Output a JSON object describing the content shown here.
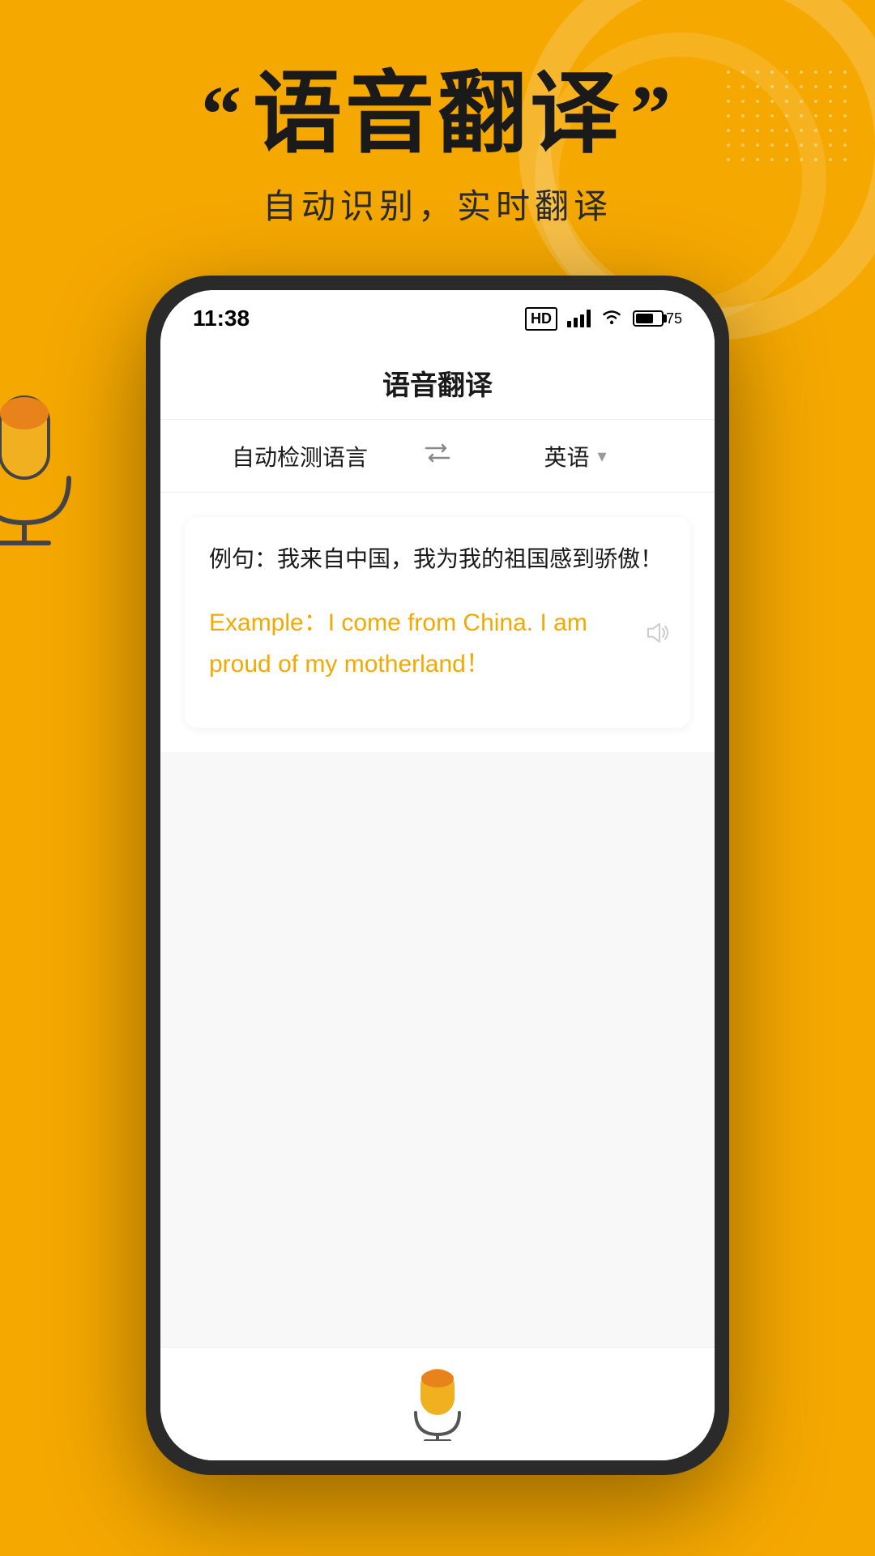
{
  "background": {
    "color": "#F5A800"
  },
  "header": {
    "quote_open": "“",
    "quote_close": "”",
    "main_title": "语音翻译",
    "subtitle": "自动识别，实时翻译"
  },
  "status_bar": {
    "time": "11:38",
    "hd_label": "HD",
    "battery_level": "75"
  },
  "app": {
    "title": "语音翻译",
    "source_lang": "自动检测语言",
    "target_lang": "英语",
    "source_text": "例句：我来自中国，我为我的祖国感到骄傲！",
    "translated_text": "Example：I come from China. I am proud of my motherland！"
  }
}
